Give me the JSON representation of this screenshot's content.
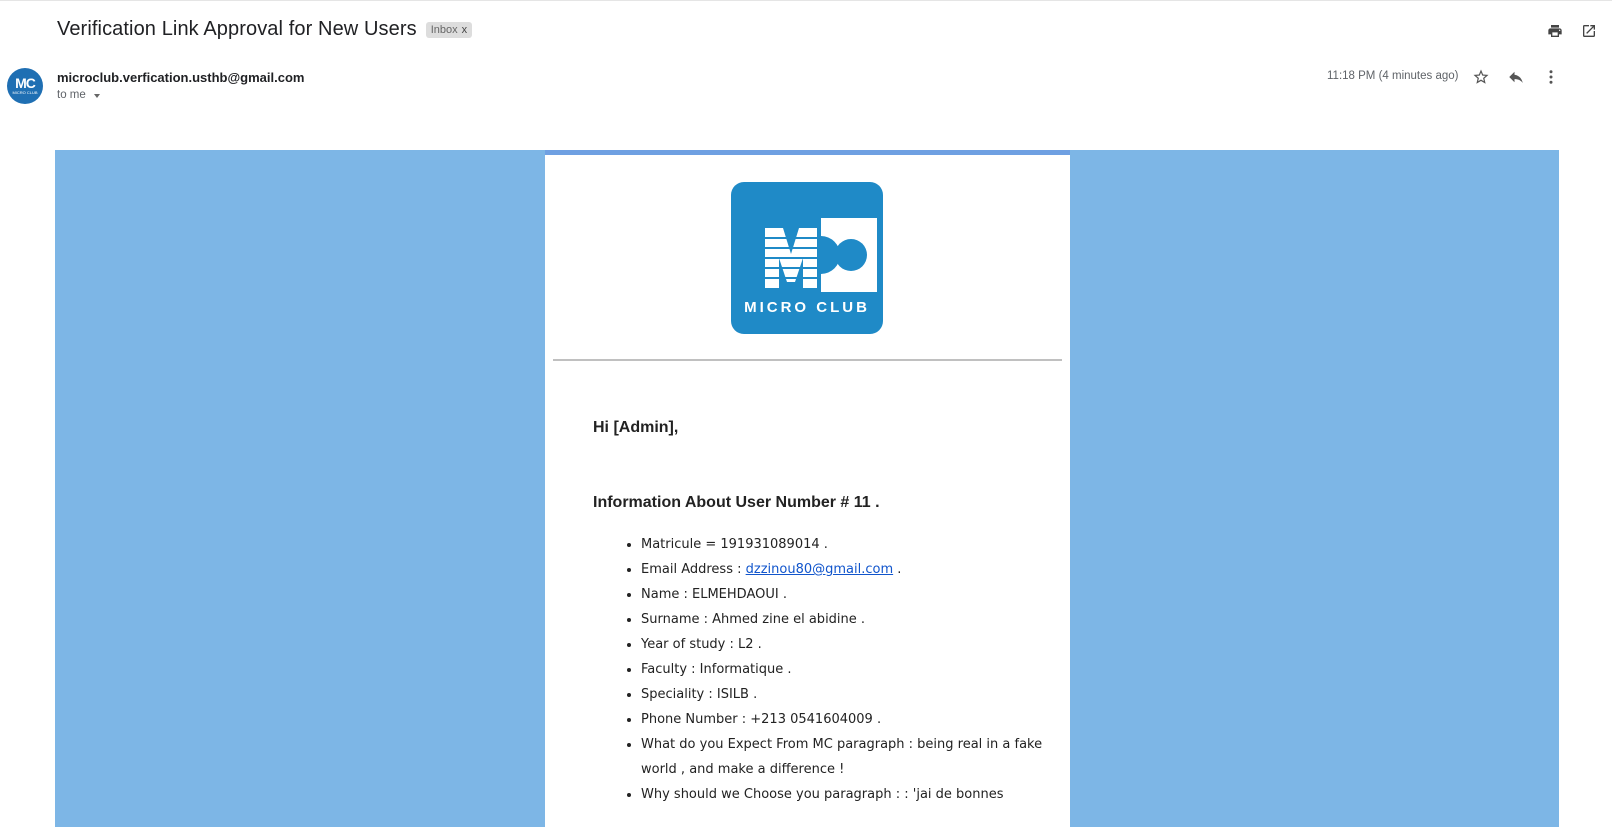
{
  "email": {
    "subject": "Verification Link Approval for New Users",
    "label": "Inbox",
    "label_remove": "x",
    "sender": "microclub.verfication.usthb@gmail.com",
    "recipient": "to me",
    "time": "11:18 PM (4 minutes ago)",
    "avatar_text": "MC",
    "avatar_subtext": "MICRO CLUB"
  },
  "icons": {
    "print": "print-icon",
    "open_new_window": "open-in-new-window-icon",
    "star": "star-icon",
    "reply": "reply-icon",
    "more": "more-vertical-icon"
  },
  "body": {
    "logo_text": "MICRO CLUB",
    "greeting": "Hi [Admin],",
    "info_title": "Information About User Number # 11 .",
    "items": [
      {
        "prefix": "Matricule = 191931089014 .",
        "link": "",
        "suffix": ""
      },
      {
        "prefix": "Email Address : ",
        "link": "dzzinou80@gmail.com",
        "suffix": " ."
      },
      {
        "prefix": "Name : ELMEHDAOUI .",
        "link": "",
        "suffix": ""
      },
      {
        "prefix": "Surname : Ahmed zine el abidine .",
        "link": "",
        "suffix": ""
      },
      {
        "prefix": "Year of study : L2 .",
        "link": "",
        "suffix": ""
      },
      {
        "prefix": "Faculty : Informatique .",
        "link": "",
        "suffix": ""
      },
      {
        "prefix": "Speciality : ISILB .",
        "link": "",
        "suffix": ""
      },
      {
        "prefix": "Phone Number : +213 0541604009 .",
        "link": "",
        "suffix": ""
      },
      {
        "prefix": "What do you Expect From MC paragraph : being real in a fake world , and make a difference !",
        "link": "",
        "suffix": ""
      },
      {
        "prefix": "Why should we Choose you paragraph : : 'jai de bonnes",
        "link": "",
        "suffix": ""
      }
    ]
  },
  "colors": {
    "email_background": "#7db6e6",
    "card_top_border": "#6fa0e2",
    "logo_blue": "#1f8ac7",
    "link": "#1155cc"
  }
}
